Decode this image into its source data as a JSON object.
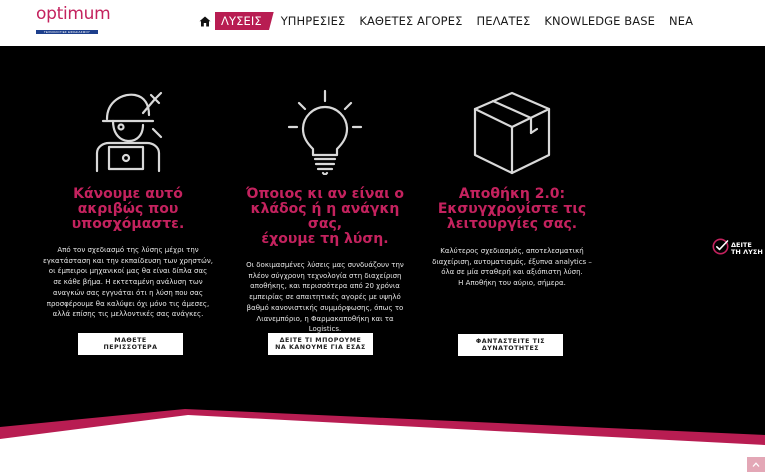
{
  "brand": {
    "logo_word": "optimum",
    "logo_tagline": "ΤΕΧΝΟΛΟΓΙΕΣ ΕΦΟΔΙΑΣΜΟΥ"
  },
  "nav": {
    "items": [
      "ΛΥΣΕΙΣ",
      "ΥΠΗΡΕΣΙΕΣ",
      "ΚΑΘΕΤΕΣ ΑΓΟΡΕΣ",
      "ΠΕΛΑΤΕΣ",
      "KNOWLEDGE BASE",
      "ΝΕΑ"
    ],
    "active": "ΛΥΣΕΙΣ"
  },
  "columns": [
    {
      "heading": [
        "Κάνουμε αυτό",
        "ακριβώς που",
        "υποσχόμαστε."
      ],
      "body": [
        "Από τον σχεδιασμό της λύσης μέχρι την",
        "εγκατάσταση και την εκπαίδευση των χρηστών,",
        "οι έμπειροι μηχανικοί μας θα είναι δίπλα σας",
        "σε κάθε βήμα. Η εκτεταμένη ανάλυση των",
        "αναγκών σας εγγυάται ότι η λύση που σας",
        "προσφέρουμε θα καλύψει όχι μόνο τις άμεσες,",
        "αλλά επίσης τις μελλοντικές σας ανάγκες."
      ],
      "button": [
        "ΜΑΘΕΤΕ",
        "ΠΕΡΙΣΣΟΤΕΡΑ"
      ]
    },
    {
      "heading": [
        "Όποιος κι αν είναι ο",
        "κλάδος ή η ανάγκη σας,",
        "έχουμε τη λύση."
      ],
      "body": [
        "Οι δοκιμασμένες λύσεις μας συνδυάζουν την",
        "πλέον σύγχρονη τεχνολογία στη διαχείριση",
        "αποθήκης, και περισσότερα από 20 χρόνια",
        "εμπειρίας σε απαιτητικές αγορές με υψηλό",
        "βαθμό κανονιστικής συμμόρφωσης, όπως το",
        "Λιανεμπόριο, η Φαρμακαποθήκη και τα",
        "Logistics."
      ],
      "button": [
        "ΔΕΙΤΕ ΤΙ ΜΠΟΡΟΥΜΕ",
        "ΝΑ ΚΑΝΟΥΜΕ ΓΙΑ ΕΣΑΣ"
      ]
    },
    {
      "heading": [
        "Αποθήκη 2.0:",
        "Εκσυγχρονίστε τις",
        "λειτουργίες σας."
      ],
      "body": [
        "Καλύτερος σχεδιασμός, αποτελεσματική",
        "διαχείριση, αυτοματισμός, έξυπνα analytics –",
        "όλα σε μία σταθερή και αξιόπιστη λύση.",
        "Η Αποθήκη του αύριο, σήμερα."
      ],
      "button": [
        "ΦΑΝΤΑΣΤΕΙΤΕ ΤΙΣ",
        "ΔΥΝΑΤΟΤΗΤΕΣ"
      ]
    }
  ],
  "side_widget": {
    "lines": [
      "ΔΕΙΤΕ",
      "ΤΗ ΛΥΣΗ"
    ]
  },
  "colors": {
    "accent": "#c4225e",
    "background": "#000000",
    "wave": "#b81d52"
  },
  "icons": [
    "home-icon",
    "engineer-wrench-icon",
    "lightbulb-icon",
    "box-icon",
    "check-circle-icon",
    "chevron-up-icon"
  ]
}
